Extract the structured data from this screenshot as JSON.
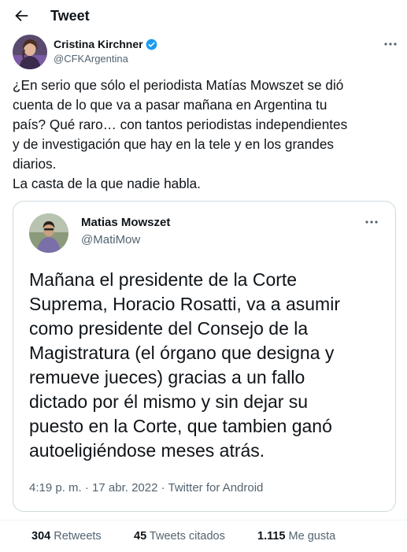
{
  "header": {
    "title": "Tweet",
    "back_icon": "arrow-left-icon"
  },
  "author": {
    "name": "Cristina Kirchner",
    "handle": "@CFKArgentina",
    "verified_icon": "verified-badge-icon",
    "verified_color": "#1d9bf0"
  },
  "tweet": {
    "lines": [
      "¿En serio que sólo el periodista Matías Mowszet se dió",
      "cuenta de lo que va a pasar mañana en Argentina tu",
      "país? Qué raro… con tantos periodistas independientes",
      "y de investigación que hay en la tele y en los grandes",
      "diarios.",
      "La casta de la que nadie habla."
    ]
  },
  "quoted": {
    "name": "Matias Mowszet",
    "handle": "@MatiMow",
    "lines": [
      "Mañana el presidente de la Corte",
      "Suprema, Horacio Rosatti, va a asumir",
      "como presidente del Consejo de la",
      "Magistratura (el órgano que designa y",
      "remueve jueces) gracias a un fallo",
      "dictado por él mismo y sin dejar su",
      "puesto en la Corte, que tambien ganó",
      "autoeligiéndose meses atrás."
    ],
    "meta": "4:19 p. m. · 17 abr. 2022 · Twitter for Android"
  },
  "stats": {
    "retweets_count": "304",
    "retweets_label": "Retweets",
    "quotes_count": "45",
    "quotes_label": "Tweets citados",
    "likes_count": "1.115",
    "likes_label": "Me gusta"
  },
  "colors": {
    "text": "#0f1419",
    "secondary": "#536471",
    "border": "#cfd9de",
    "accent": "#1d9bf0"
  }
}
